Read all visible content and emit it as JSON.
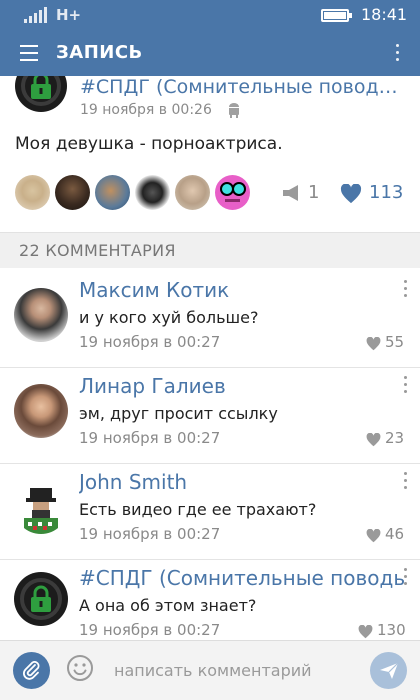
{
  "status_bar": {
    "network": "H+",
    "time": "18:41"
  },
  "header": {
    "title": "ЗАПИСЬ"
  },
  "post": {
    "group": "#СПДГ (Сомнительные поводы...",
    "time": "19 ноября в 00:26",
    "text": "Моя девушка - порноактриса.",
    "reposts": "1",
    "likes": "113"
  },
  "comments_header": "22 КОММЕНТАРИЯ",
  "comments": [
    {
      "name": "Максим Котик",
      "text": "и у кого хуй больше?",
      "date": "19 ноября в 00:27",
      "likes": "55"
    },
    {
      "name": "Линар Галиев",
      "text": "эм, друг просит ссылку",
      "date": "19 ноября в 00:27",
      "likes": "23"
    },
    {
      "name": "John Smith",
      "text": "Есть видео где ее трахают?",
      "date": "19 ноября в 00:27",
      "likes": "46"
    },
    {
      "name": "#СПДГ (Сомнительные поводы для",
      "text": "А она об этом знает?",
      "date": "19 ноября в 00:27",
      "likes": "130"
    }
  ],
  "input": {
    "placeholder": "написать комментарий"
  },
  "colors": {
    "brand": "#4a76a8",
    "secondary_text": "#8a8a8a",
    "lock_green": "#2e9e3f"
  },
  "icons": [
    "menu-icon",
    "more-icon",
    "android-icon",
    "repost-icon",
    "heart-icon",
    "attach-icon",
    "smile-icon",
    "send-icon"
  ]
}
